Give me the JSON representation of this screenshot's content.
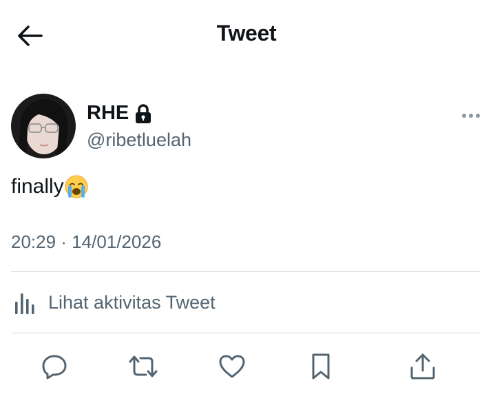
{
  "header": {
    "title": "Tweet",
    "back_icon": "arrow-left-icon"
  },
  "author": {
    "display_name": "RHE",
    "handle": "@ribetluelah",
    "protected_icon": "lock-icon",
    "avatar": "profile-photo"
  },
  "tweet": {
    "text": "finally",
    "emoji": "loudly-crying-face-emoji",
    "timestamp": "20:29 · 14/01/2026"
  },
  "activity": {
    "label": "Lihat aktivitas Tweet",
    "icon": "analytics-bars-icon"
  },
  "actions": [
    {
      "icon": "reply-icon"
    },
    {
      "icon": "retweet-icon"
    },
    {
      "icon": "like-icon"
    },
    {
      "icon": "bookmark-icon"
    },
    {
      "icon": "share-icon"
    }
  ],
  "colors": {
    "text": "#0f1419",
    "secondary": "#536471",
    "divider": "#cfd9de"
  }
}
